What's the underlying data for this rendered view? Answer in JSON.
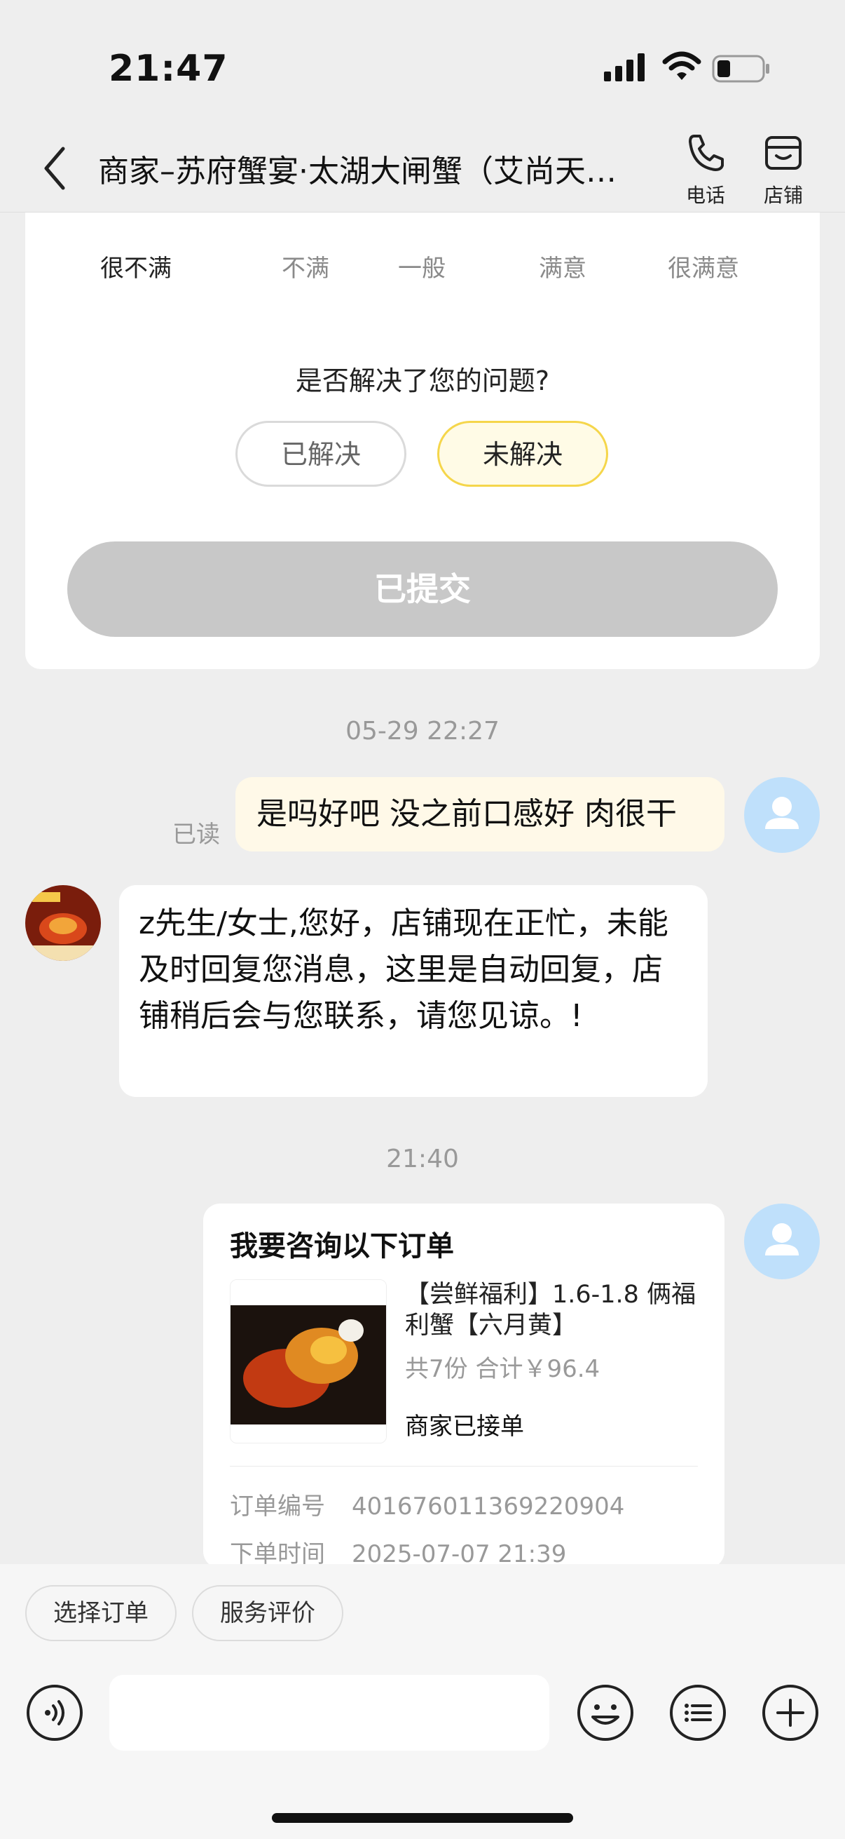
{
  "status_bar": {
    "time": "21:47"
  },
  "header": {
    "title": "商家–苏府蟹宴·太湖大闸蟹（艾尚天…",
    "phone_label": "电话",
    "store_label": "店铺"
  },
  "rating": {
    "options": [
      "很不满",
      "不满",
      "一般",
      "满意",
      "很满意"
    ],
    "selected": "很不满",
    "question": "是否解决了您的问题?",
    "resolved_label": "已解决",
    "unresolved_label": "未解决",
    "submit_label": "已提交"
  },
  "messages": {
    "timestamp_1": "05-29 22:27",
    "user_message": "是吗好吧 没之前口感好 肉很干",
    "read_status": "已读",
    "shop_reply": "z先生/女士,您好，店铺现在正忙，未能及时回复您消息，这里是自动回复，店铺稍后会与您联系，请您见谅。!",
    "timestamp_2": "21:40"
  },
  "order_card": {
    "title": "我要咨询以下订单",
    "product_name": "【尝鲜福利】1.6-1.8 俩福利蟹【六月黄】",
    "summary": "共7份 合计￥96.4",
    "status": "商家已接单",
    "order_number_label": "订单编号",
    "order_number": "401676011369220904",
    "order_time_label": "下单时间",
    "order_time": "2025-07-07 21:39"
  },
  "quick_actions": {
    "select_order": "选择订单",
    "service_rating": "服务评价"
  },
  "colors": {
    "background": "#eeeeee",
    "accent_yellow": "#f5d64b",
    "selected_face": "#ff5a2a",
    "user_avatar": "#bfe0fb",
    "submit_disabled": "#c8c8c8"
  }
}
